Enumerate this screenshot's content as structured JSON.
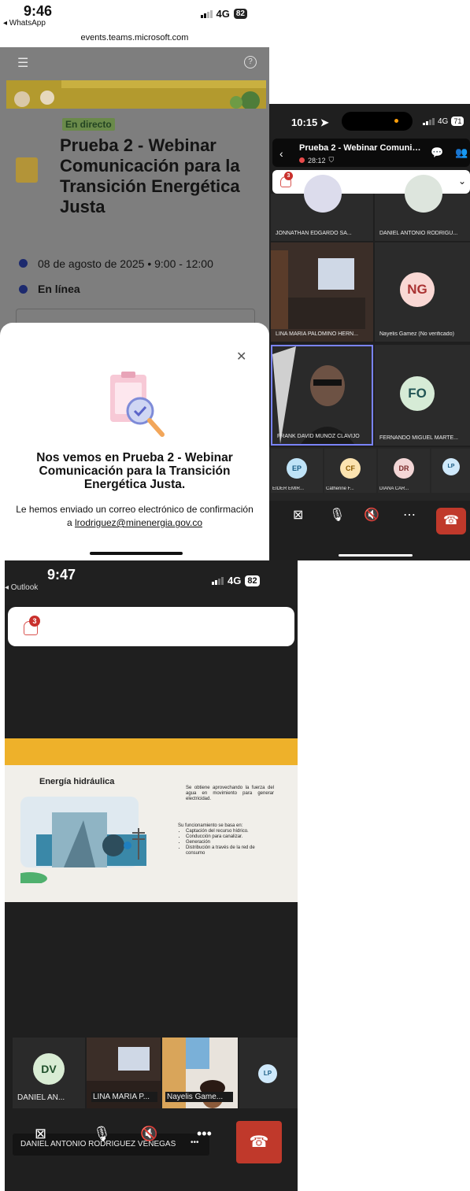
{
  "whatsapp_screen": {
    "status": {
      "time": "9:46",
      "back_app": "◂ WhatsApp",
      "network": "4G",
      "battery": "82"
    },
    "url": "events.teams.microsoft.com",
    "event": {
      "badge": "En directo",
      "title": "Prueba 2 - Webinar Comunicación para la Transición Energética Justa",
      "date": "08 de agosto de 2025 • 9:00 - 12:00",
      "location": "En línea"
    },
    "modal": {
      "title": "Nos vemos en Prueba 2 - Webinar Comunicación para la Transición Energética Justa.",
      "body": "Le hemos enviado un correo electrónico de confirmación a",
      "email": "lrodriguez@minenergia.gov.co"
    }
  },
  "teams_grid_screen": {
    "status": {
      "time": "10:15",
      "network": "4G",
      "battery": "71"
    },
    "meeting": {
      "title": "Prueba 2 - Webinar Comunica...",
      "timer": "28:12"
    },
    "notifications": {
      "label": "Notificaciones (3)",
      "count": "3"
    },
    "participants": [
      {
        "name": "JONNATHAN EDGARDO SA...",
        "initials": ""
      },
      {
        "name": "DANIEL ANTONIO RODRIGU...",
        "initials": ""
      },
      {
        "name": "LINA MARIA PALOMINO HERN...",
        "initials": ""
      },
      {
        "name": "Nayelis Gamez (No verificado)",
        "initials": "NG"
      },
      {
        "name": "FRANK DAVID MUNOZ CLAVIJO",
        "initials": ""
      },
      {
        "name": "FERNANDO MIGUEL MARTE...",
        "initials": "FO"
      }
    ],
    "strip": [
      {
        "name": "EIDER EMIR...",
        "initials": "EP",
        "color": "#bfe3f7"
      },
      {
        "name": "Catherine F...",
        "initials": "CF",
        "color": "#fbe3b0"
      },
      {
        "name": "DIANA CAR...",
        "initials": "DR",
        "color": "#f3d6d6"
      },
      {
        "name": "",
        "initials": "LP",
        "color": "#cfe9fb"
      }
    ]
  },
  "teams_slide_screen": {
    "status": {
      "time": "9:47",
      "back_app": "◂ Outlook",
      "network": "4G",
      "battery": "82"
    },
    "notifications": {
      "label": "Notificaciones (3)",
      "count": "3"
    },
    "slide": {
      "heading": "Energía hidráulica",
      "description": "Se obtiene aprovechando la fuerza del agua en movimiento para generar electricidad.",
      "list_intro": "Su funcionamiento se basa en:",
      "list": [
        "Captación del recurso hídrico.",
        "Conducción para canalizar.",
        "Generación",
        "Distribución a través de la red de consumo"
      ]
    },
    "speaker_label": "DANIEL ANTONIO RODRIGUEZ VENEGAS",
    "speaker_more": "•••",
    "participants": [
      {
        "name": "DANIEL AN...",
        "initials": "DV"
      },
      {
        "name": "LINA MARIA P...",
        "initials": ""
      },
      {
        "name": "Nayelis Game...",
        "initials": ""
      },
      {
        "name": "",
        "initials": "LP"
      }
    ],
    "more_label": "•••"
  }
}
